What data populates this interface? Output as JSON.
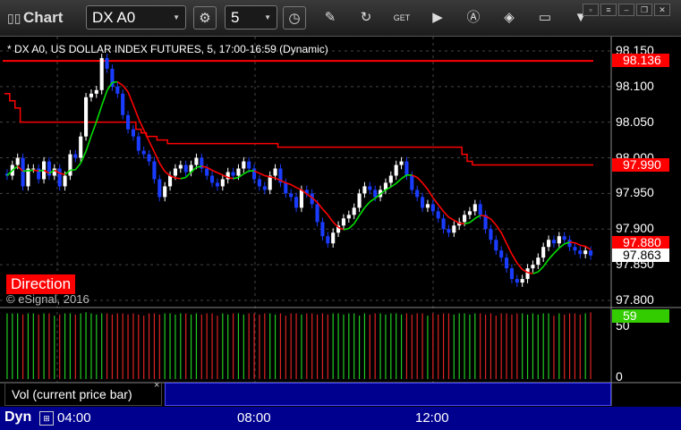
{
  "toolbar": {
    "title": "Chart",
    "symbol": "DX A0",
    "interval": "5",
    "icons": [
      "settings-gear-icon",
      "clock-icon",
      "pencil-icon",
      "refresh-icon",
      "get-icon",
      "play-icon",
      "alert-icon",
      "dollar-tag-icon",
      "comment-icon",
      "filter-icon"
    ]
  },
  "chart_header": "* DX A0, US DOLLAR INDEX FUTURES, 5, 17:00-16:59 (Dynamic)",
  "direction_badge": "Direction",
  "copyright": "© eSignal, 2016",
  "price_axis": {
    "ticks": [
      "98.150",
      "98.100",
      "98.050",
      "98.000",
      "97.950",
      "97.900",
      "97.850",
      "97.800"
    ],
    "tags": [
      {
        "value": "98.136",
        "bg": "#ff0000",
        "fg": "#ffffff"
      },
      {
        "value": "97.990",
        "bg": "#ff0000",
        "fg": "#ffffff"
      },
      {
        "value": "97.880",
        "bg": "#ff0000",
        "fg": "#ffffff"
      },
      {
        "value": "97.863",
        "bg": "#ffffff",
        "fg": "#000000"
      }
    ]
  },
  "volume_axis": {
    "ticks": [
      "50",
      "0"
    ],
    "tag": {
      "value": "59",
      "bg": "#33cc00",
      "fg": "#ffffff"
    }
  },
  "volume_label": "Vol (current price bar)",
  "close_glyph": "×",
  "time_axis": {
    "mode": "Dyn",
    "ticks": [
      "04:00",
      "08:00",
      "12:00"
    ]
  },
  "colors": {
    "background": "#000000",
    "up_candle": "#ffffff",
    "down_candle": "#1a3cff",
    "upper_band": "#ff0000",
    "ma_up": "#00e000",
    "ma_down": "#ff0000",
    "vol_up": "#22cc22",
    "vol_down": "#dd2222"
  },
  "chart_data": {
    "type": "candlestick",
    "title": "* DX A0, US DOLLAR INDEX FUTURES, 5, 17:00-16:59 (Dynamic)",
    "ylim": [
      97.79,
      98.17
    ],
    "x_ticks": [
      "04:00",
      "08:00",
      "12:00"
    ],
    "closes": [
      97.975,
      97.99,
      98.0,
      97.96,
      97.985,
      97.985,
      97.97,
      97.995,
      97.975,
      97.985,
      97.96,
      97.975,
      98.005,
      98.0,
      98.03,
      98.085,
      98.09,
      98.095,
      98.14,
      98.125,
      98.1,
      98.09,
      98.06,
      98.04,
      98.03,
      98.01,
      98.005,
      97.995,
      97.97,
      97.945,
      97.96,
      97.975,
      97.985,
      97.99,
      97.98,
      97.99,
      98.0,
      97.985,
      97.975,
      97.965,
      97.96,
      97.97,
      97.98,
      97.975,
      97.985,
      97.995,
      97.985,
      97.97,
      97.96,
      97.955,
      97.975,
      97.985,
      97.965,
      97.95,
      97.945,
      97.93,
      97.955,
      97.95,
      97.935,
      97.91,
      97.89,
      97.88,
      97.895,
      97.905,
      97.915,
      97.92,
      97.93,
      97.95,
      97.96,
      97.955,
      97.945,
      97.955,
      97.965,
      97.975,
      97.99,
      97.995,
      97.975,
      97.955,
      97.945,
      97.93,
      97.935,
      97.925,
      97.915,
      97.9,
      97.895,
      97.905,
      97.91,
      97.92,
      97.925,
      97.935,
      97.92,
      97.9,
      97.885,
      97.87,
      97.86,
      97.845,
      97.83,
      97.825,
      97.83,
      97.845,
      97.85,
      97.86,
      97.875,
      97.885,
      97.88,
      97.89,
      97.885,
      97.875,
      97.87,
      97.865,
      97.87,
      97.863
    ],
    "upper_band": [
      98.09,
      98.08,
      98.07,
      98.05,
      98.05,
      98.05,
      98.05,
      98.05,
      98.05,
      98.05,
      98.05,
      98.05,
      98.05,
      98.05,
      98.05,
      98.05,
      98.05,
      98.05,
      98.05,
      98.05,
      98.05,
      98.05,
      98.05,
      98.05,
      98.05,
      98.04,
      98.035,
      98.03,
      98.03,
      98.025,
      98.025,
      98.02,
      98.02,
      98.02,
      98.02,
      98.02,
      98.02,
      98.02,
      98.02,
      98.02,
      98.02,
      98.02,
      98.02,
      98.02,
      98.02,
      98.02,
      98.02,
      98.02,
      98.02,
      98.02,
      98.02,
      98.02,
      98.015,
      98.015,
      98.015,
      98.015,
      98.015,
      98.015,
      98.015,
      98.015,
      98.015,
      98.015,
      98.015,
      98.015,
      98.015,
      98.015,
      98.015,
      98.015,
      98.015,
      98.015,
      98.015,
      98.015,
      98.015,
      98.015,
      98.015,
      98.015,
      98.015,
      98.015,
      98.015,
      98.015,
      98.015,
      98.015,
      98.015,
      98.015,
      98.015,
      98.015,
      98.015,
      98.005,
      97.995,
      97.99,
      97.99,
      97.99,
      97.99,
      97.99,
      97.99,
      97.99,
      97.99,
      97.99,
      97.99,
      97.99,
      97.99,
      97.99,
      97.99,
      97.99,
      97.99,
      97.99,
      97.99,
      97.99,
      97.99,
      97.99,
      97.99,
      97.99
    ],
    "resistance_level": 98.136,
    "last_price": 97.863,
    "volume": [
      58,
      58,
      58,
      57,
      58,
      58,
      57,
      58,
      58,
      56,
      57,
      58,
      58,
      57,
      58,
      59,
      58,
      57,
      58,
      58,
      57,
      58,
      58,
      57,
      58,
      57,
      56,
      58,
      58,
      57,
      58,
      58,
      57,
      58,
      58,
      57,
      58,
      57,
      58,
      58,
      56,
      58,
      57,
      58,
      58,
      57,
      58,
      58,
      57,
      58,
      58,
      57,
      58,
      56,
      58,
      58,
      57,
      58,
      58,
      57,
      58,
      57,
      58,
      58,
      57,
      58,
      58,
      56,
      58,
      57,
      58,
      58,
      57,
      58,
      58,
      57,
      58,
      57,
      58,
      58,
      56,
      58,
      57,
      58,
      58,
      57,
      58,
      58,
      57,
      58,
      58,
      57,
      58,
      56,
      58,
      58,
      57,
      58,
      58,
      57,
      58,
      57,
      58,
      58,
      56,
      58,
      57,
      58,
      58,
      57,
      58,
      59
    ],
    "volume_last": 59,
    "volume_ylim": [
      0,
      60
    ]
  }
}
